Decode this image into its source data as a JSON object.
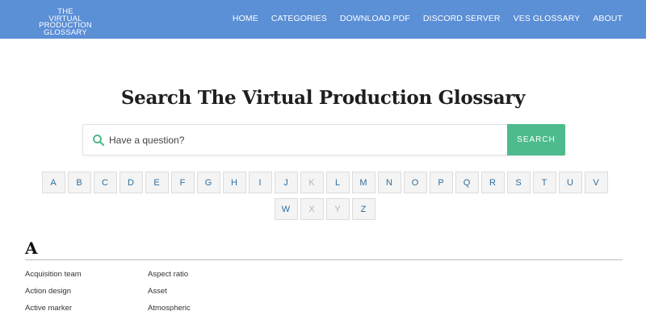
{
  "header": {
    "logo_lines": [
      "THE",
      "VIRTUAL PRODUCTION",
      "GLOSSARY"
    ],
    "nav": [
      "HOME",
      "CATEGORIES",
      "DOWNLOAD PDF",
      "DISCORD SERVER",
      "VES GLOSSARY",
      "ABOUT"
    ]
  },
  "main": {
    "title": "Search The Virtual Production Glossary",
    "search": {
      "placeholder": "Have a question?",
      "button_label": "SEARCH"
    },
    "letters_row1": [
      "A",
      "B",
      "C",
      "D",
      "E",
      "F",
      "G",
      "H",
      "I",
      "J",
      "K",
      "L",
      "M",
      "N",
      "O",
      "P",
      "Q",
      "R",
      "S",
      "T",
      "U",
      "V"
    ],
    "letters_row2": [
      "W",
      "X",
      "Y",
      "Z"
    ],
    "disabled_letters": [
      "K",
      "X",
      "Y"
    ]
  },
  "section": {
    "heading": "A",
    "terms": [
      [
        "Acquisition team",
        "Aspect ratio"
      ],
      [
        "Action design",
        "Asset"
      ],
      [
        "Active marker",
        "Atmospheric"
      ]
    ]
  },
  "colors": {
    "header_bg": "#5b8fd6",
    "search_button": "#4dbb8c",
    "letter_text": "#2e6f9e"
  },
  "icons": {
    "search": "search-icon"
  }
}
